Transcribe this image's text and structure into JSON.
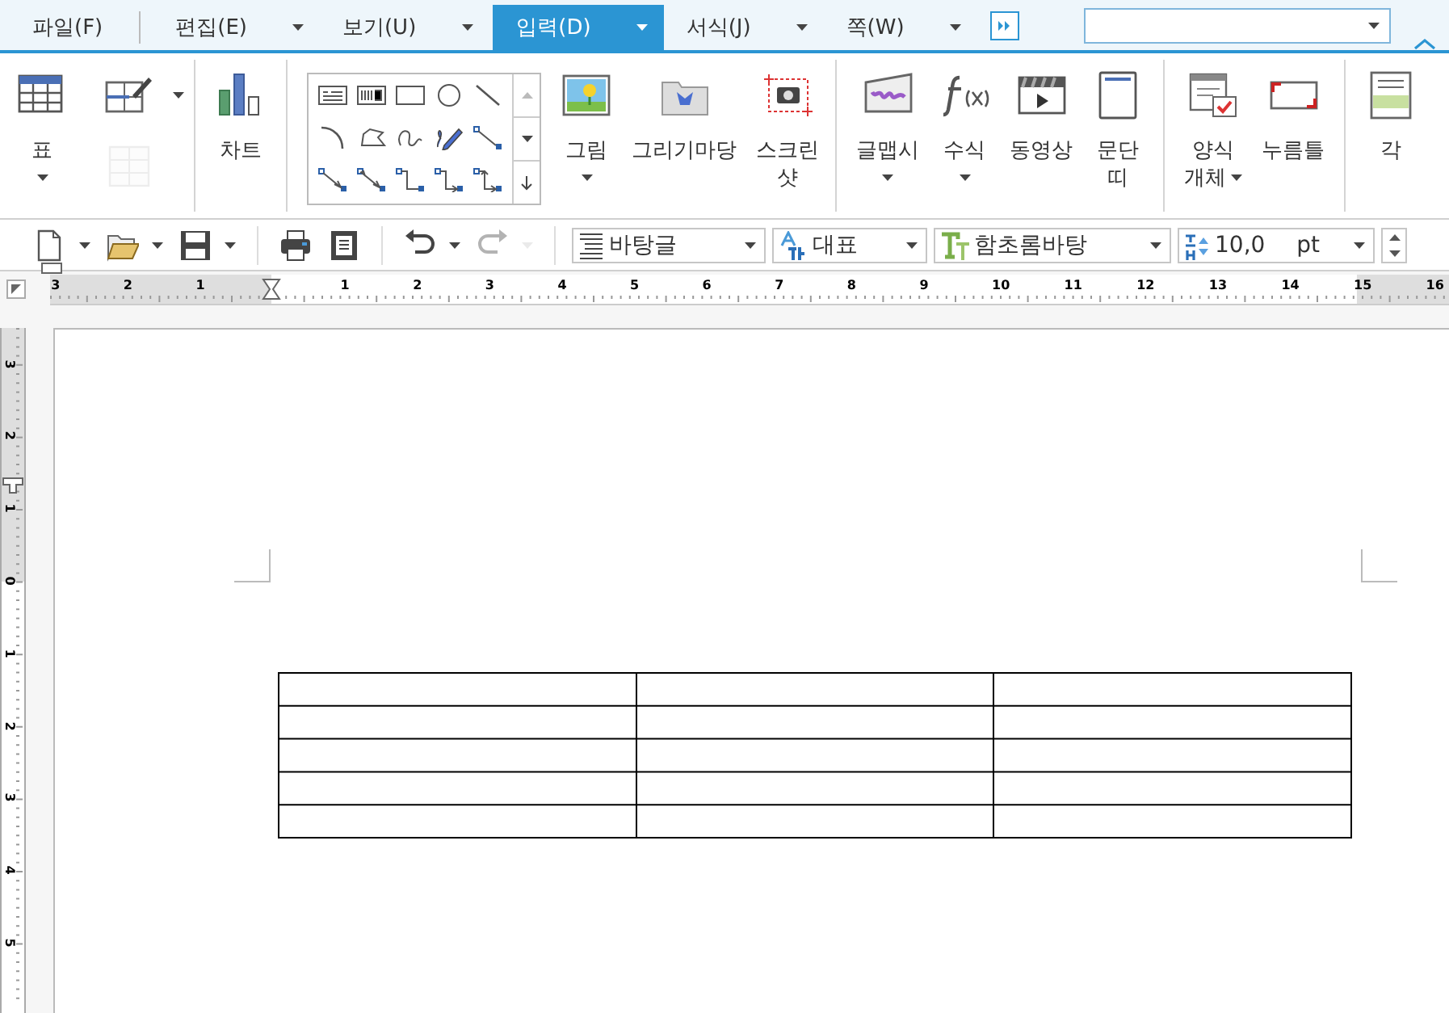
{
  "menu_tabs": [
    {
      "label": "파일(F)",
      "dropdown": false,
      "selected": false
    },
    {
      "label": "편집(E)",
      "dropdown": true,
      "selected": false
    },
    {
      "label": "보기(U)",
      "dropdown": true,
      "selected": false
    },
    {
      "label": "입력(D)",
      "dropdown": true,
      "selected": true
    },
    {
      "label": "서식(J)",
      "dropdown": true,
      "selected": false
    },
    {
      "label": "쪽(W)",
      "dropdown": true,
      "selected": false
    }
  ],
  "ribbon": {
    "groups": [
      {
        "kind": "table",
        "items": [
          {
            "label": "표",
            "kind": "dropdown",
            "disabled": false
          },
          {
            "kind": "split",
            "disabled": false
          },
          {
            "kind": "plain",
            "disabled": true
          }
        ]
      },
      {
        "kind": "large",
        "items": [
          {
            "label": "차트",
            "kind": "plain",
            "disabled": false
          }
        ]
      },
      {
        "kind": "gallery",
        "items": [
          {
            "label": "그림",
            "kind": "dropdown",
            "disabled": false
          },
          {
            "label": "그리기마당",
            "kind": "plain",
            "disabled": false
          },
          {
            "label": "스크린\n샷",
            "kind": "plain",
            "disabled": false
          }
        ]
      },
      {
        "kind": "large",
        "items": [
          {
            "label": "글맵시",
            "kind": "dropdown",
            "disabled": false
          },
          {
            "label": "수식",
            "kind": "dropdown",
            "disabled": false
          },
          {
            "label": "동영상",
            "kind": "plain",
            "disabled": false
          },
          {
            "label": "문단\n띠",
            "kind": "plain",
            "disabled": false
          }
        ]
      },
      {
        "kind": "large",
        "items": [
          {
            "label": "양식\n개체",
            "kind": "inline",
            "disabled": false
          },
          {
            "label": "누름틀",
            "kind": "plain",
            "disabled": false
          }
        ]
      },
      {
        "kind": "large",
        "items": [
          {
            "label": "각",
            "kind": "plain",
            "disabled": false
          }
        ]
      }
    ]
  },
  "toolbar": {
    "buttons": [
      {
        "dropdown": true,
        "disabled": false
      },
      {
        "dropdown": true,
        "disabled": false
      },
      {
        "dropdown": true,
        "disabled": false
      },
      {
        "dropdown": false,
        "disabled": false
      },
      {
        "dropdown": false,
        "disabled": false
      },
      {
        "dropdown": true,
        "disabled": false
      },
      {
        "dropdown": true,
        "disabled": true
      }
    ],
    "combos": [
      {
        "value": "바탕글"
      },
      {
        "value": "대표"
      },
      {
        "value": "함초롬바탕"
      },
      {
        "value": "10,0",
        "unit": "pt"
      }
    ]
  },
  "horizontal_ruler": {
    "labels": [
      "3",
      "2",
      "1",
      "1",
      "2",
      "3",
      "4",
      "5",
      "6",
      "7",
      "8",
      "9",
      "10",
      "11",
      "12",
      "13",
      "14",
      "15",
      "16"
    ]
  },
  "vertical_ruler": {
    "labels": [
      "3",
      "2",
      "1",
      "0",
      "1",
      "2",
      "3",
      "4",
      "5"
    ]
  }
}
